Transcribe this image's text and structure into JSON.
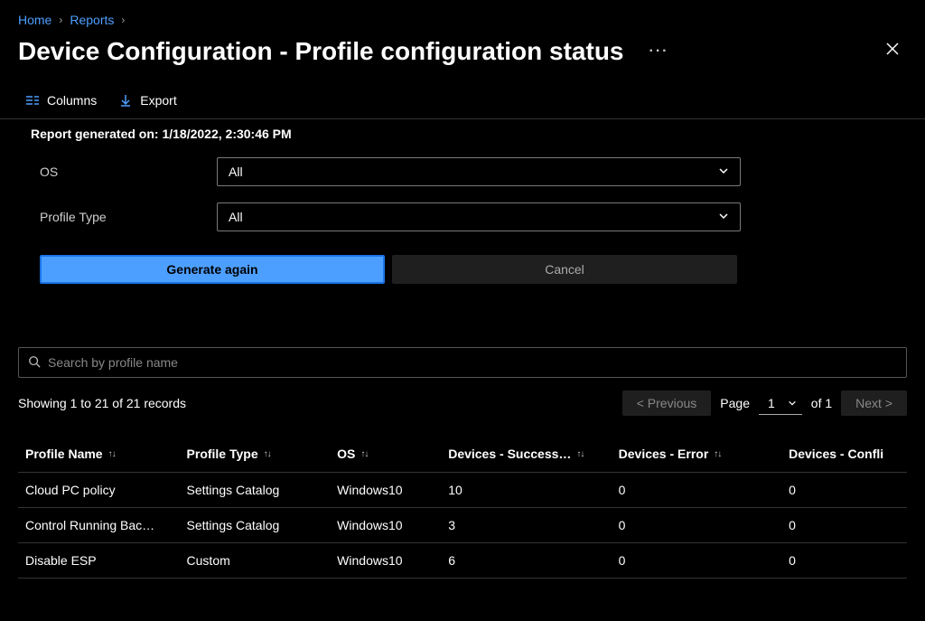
{
  "breadcrumb": {
    "items": [
      "Home",
      "Reports"
    ]
  },
  "header": {
    "title": "Device Configuration - Profile configuration status",
    "more": "···"
  },
  "toolbar": {
    "columns_label": "Columns",
    "export_label": "Export"
  },
  "report": {
    "generated_on_label": "Report generated on:",
    "generated_on_value": "1/18/2022, 2:30:46 PM"
  },
  "filters": {
    "os_label": "OS",
    "os_value": "All",
    "profile_type_label": "Profile Type",
    "profile_type_value": "All"
  },
  "actions": {
    "generate_label": "Generate again",
    "cancel_label": "Cancel"
  },
  "search": {
    "placeholder": "Search by profile name"
  },
  "records": {
    "showing_text": "Showing 1 to 21 of 21 records"
  },
  "pager": {
    "previous_label": "< Previous",
    "page_label": "Page",
    "page_value": "1",
    "of_text": "of 1",
    "next_label": "Next >"
  },
  "table": {
    "headers": {
      "profile_name": "Profile Name",
      "profile_type": "Profile Type",
      "os": "OS",
      "devices_success": "Devices - Success…",
      "devices_error": "Devices - Error",
      "devices_conflict": "Devices - Confli"
    },
    "rows": [
      {
        "profile_name": "Cloud PC policy",
        "profile_type": "Settings Catalog",
        "os": "Windows10",
        "devices_success": "10",
        "devices_error": "0",
        "devices_conflict": "0"
      },
      {
        "profile_name": "Control Running Bac…",
        "profile_type": "Settings Catalog",
        "os": "Windows10",
        "devices_success": "3",
        "devices_error": "0",
        "devices_conflict": "0"
      },
      {
        "profile_name": "Disable ESP",
        "profile_type": "Custom",
        "os": "Windows10",
        "devices_success": "6",
        "devices_error": "0",
        "devices_conflict": "0"
      }
    ]
  },
  "sort_glyph": "↑↓"
}
